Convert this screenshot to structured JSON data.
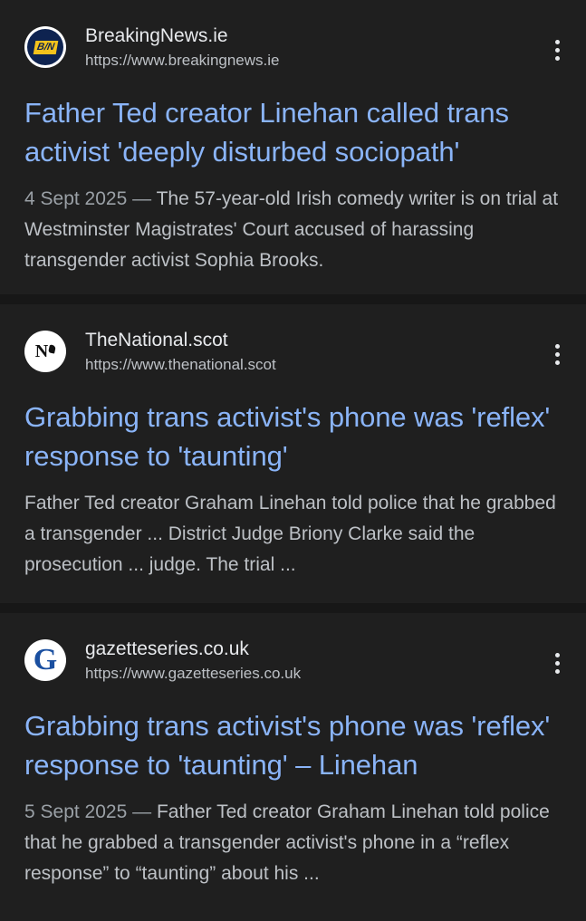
{
  "results": [
    {
      "favicon_icon": "breakingnews-logo-icon",
      "favicon_text": "B/N",
      "site_name": "BreakingNews.ie",
      "site_url": "https://www.breakingnews.ie",
      "title": "Father Ted creator Linehan called trans activist 'deeply disturbed sociopath'",
      "date": "4 Sept 2025",
      "date_separator": " — ",
      "snippet": "The 57-year-old Irish comedy writer is on trial at Westminster Magistrates' Court accused of harassing transgender activist Sophia Brooks."
    },
    {
      "favicon_icon": "thenational-logo-icon",
      "favicon_text": "N",
      "site_name": "TheNational.scot",
      "site_url": "https://www.thenational.scot",
      "title": "Grabbing trans activist's phone was 'reflex' response to 'taunting'",
      "snippet": "Father Ted creator Graham Linehan told police that he grabbed a transgender ... District Judge Briony Clarke said the prosecution ... judge. The trial ..."
    },
    {
      "favicon_icon": "gazette-logo-icon",
      "favicon_text": "G",
      "site_name": "gazetteseries.co.uk",
      "site_url": "https://www.gazetteseries.co.uk",
      "title": "Grabbing trans activist's phone was 'reflex' response to 'taunting' – Linehan",
      "date": "5 Sept 2025",
      "date_separator": " — ",
      "snippet": "Father Ted creator Graham Linehan told police that he grabbed a transgender activist's phone in a “reflex response” to “taunting” about his ..."
    }
  ],
  "colors": {
    "background": "#171717",
    "card": "#1f1f1f",
    "title_link": "#8ab4f8",
    "site_name": "#e8eaed",
    "site_url": "#bdc1c6",
    "snippet": "#bdc1c6",
    "date": "#9aa0a6"
  }
}
